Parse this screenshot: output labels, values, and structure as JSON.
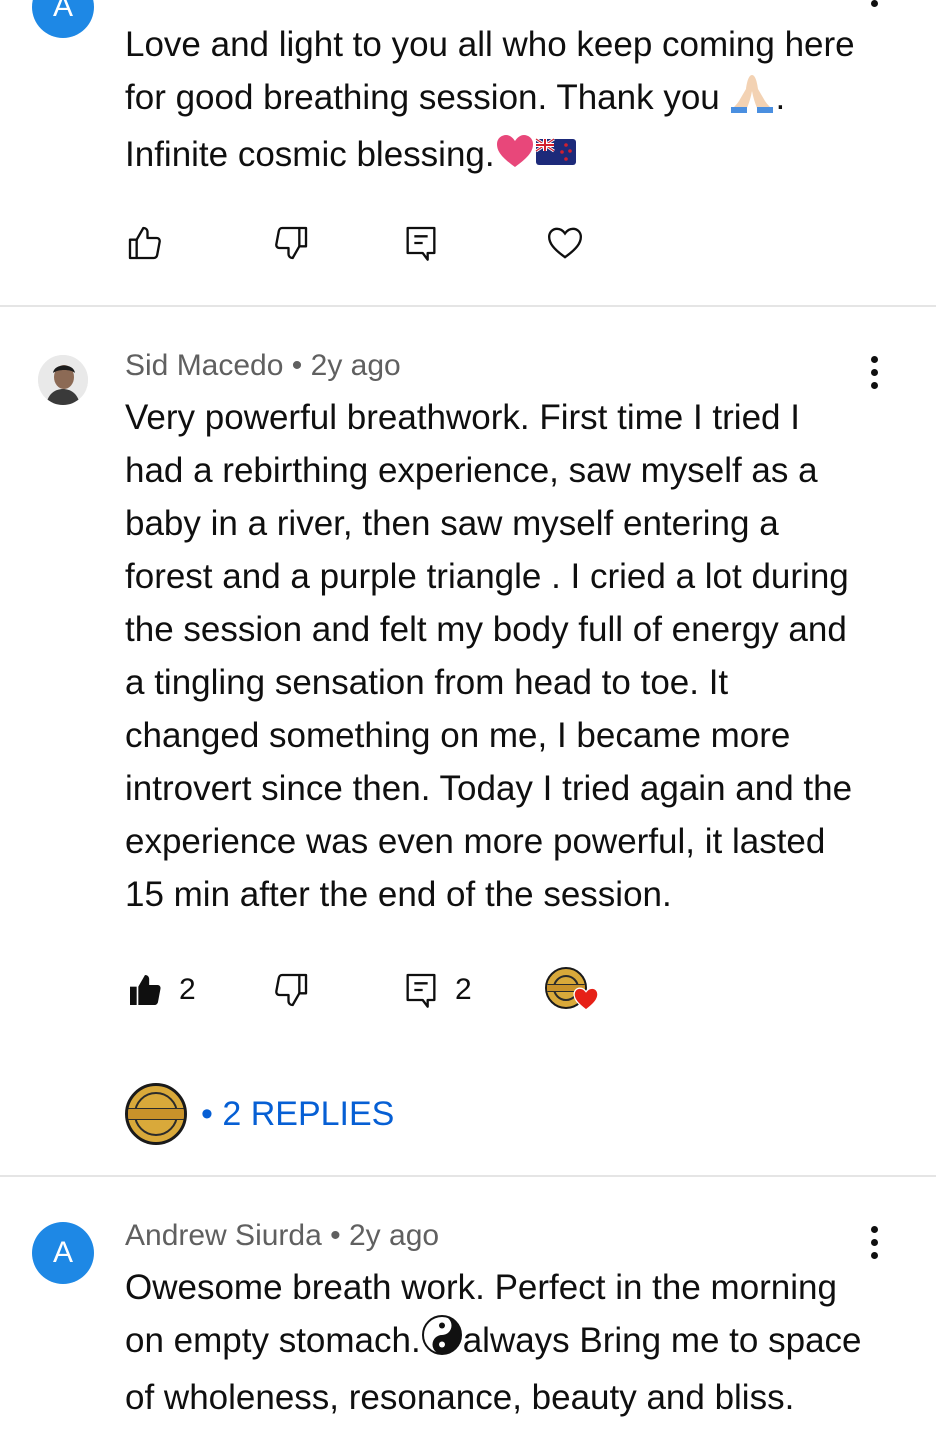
{
  "comments": [
    {
      "avatar_letter": "A",
      "body_lines": [
        "Love and light to you all who keep coming here",
        "for good breathing session. Thank you",
        "Infinite cosmic blessing."
      ],
      "emoji": [
        "folded-hands",
        "pink-heart",
        "new-zealand-flag"
      ],
      "punct_after_emoji": "."
    },
    {
      "author": "Sid Macedo",
      "time": "2y ago",
      "body_lines": [
        "Very powerful breathwork. First time I tried I",
        "had a rebirthing experience, saw myself as a",
        "baby in a river, then saw myself entering a",
        "forest and a purple triangle . I cried a lot during",
        "the session and felt my body full of energy and",
        "a tingling sensation from head to toe. It",
        "changed something on me, I became more",
        "introvert since then. Today I tried again and the",
        "experience was even more powerful, it lasted",
        "15 min after the end of the session."
      ],
      "likes": "2",
      "replies_count": "2",
      "replies_label": "2 REPLIES",
      "bullet": "•"
    },
    {
      "avatar_letter": "A",
      "author": "Andrew Siurda",
      "time": "2y ago",
      "body_lines": [
        "Owesome breath work. Perfect in the morning",
        "on empty stomach.",
        "always Bring me to space",
        "of wholeness, resonance, beauty and bliss."
      ],
      "emoji": [
        "yin-yang"
      ]
    }
  ],
  "separator": "•",
  "colors": {
    "link_blue": "#065fd4",
    "avatar_blue": "#1e88e5",
    "meta_gray": "#606060",
    "heart_red": "#e62117"
  }
}
